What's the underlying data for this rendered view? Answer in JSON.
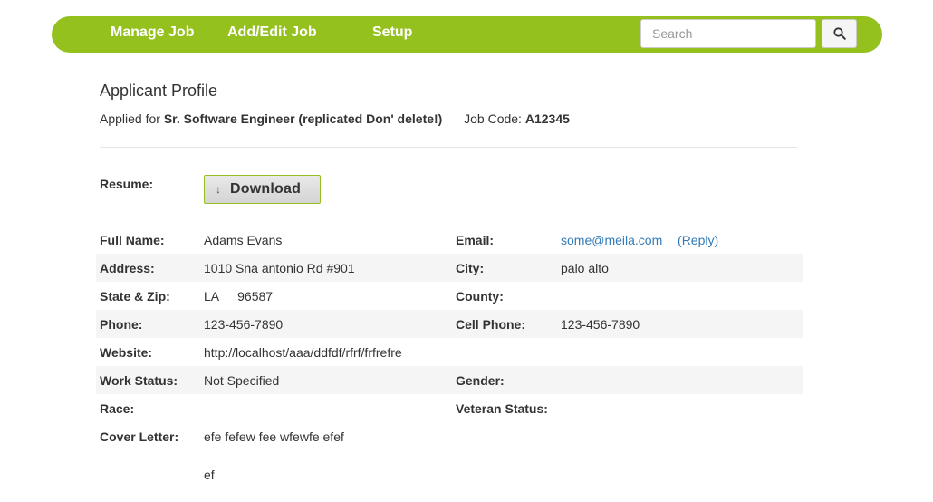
{
  "nav": {
    "links": [
      "Manage Job",
      "Add/Edit Job",
      "Setup"
    ],
    "search_placeholder": "Search",
    "search_icon": "search-icon",
    "brand_color": "#95c11f"
  },
  "header": {
    "title": "Applicant Profile",
    "applied_prefix": "Applied for",
    "job_title": "Sr. Software Engineer (replicated Don' delete!)",
    "job_code_label": "Job Code:",
    "job_code": "A12345"
  },
  "resume": {
    "label": "Resume:",
    "download_label": "Download",
    "download_icon": "download-arrow-icon"
  },
  "fields": {
    "full_name": {
      "label": "Full Name:",
      "value": "Adams Evans"
    },
    "email": {
      "label": "Email:",
      "value": "some@meila.com",
      "reply": "(Reply)"
    },
    "address": {
      "label": "Address:",
      "value": "1010 Sna antonio Rd #901"
    },
    "city": {
      "label": "City:",
      "value": "palo alto"
    },
    "state_zip": {
      "label": "State & Zip:",
      "state": "LA",
      "zip": "96587"
    },
    "county": {
      "label": "County:",
      "value": ""
    },
    "phone": {
      "label": "Phone:",
      "value": "123-456-7890"
    },
    "cell_phone": {
      "label": "Cell Phone:",
      "value": "123-456-7890"
    },
    "website": {
      "label": "Website:",
      "value": "http://localhost/aaa/ddfdf/rfrf/frfrefre"
    },
    "work_status": {
      "label": "Work Status:",
      "value": "Not Specified"
    },
    "gender": {
      "label": "Gender:",
      "value": ""
    },
    "race": {
      "label": "Race:",
      "value": ""
    },
    "veteran_status": {
      "label": "Veteran Status:",
      "value": ""
    },
    "cover_letter": {
      "label": "Cover Letter:",
      "line1": "efe fefew fee wfewfe efef",
      "line2": "ef"
    }
  }
}
